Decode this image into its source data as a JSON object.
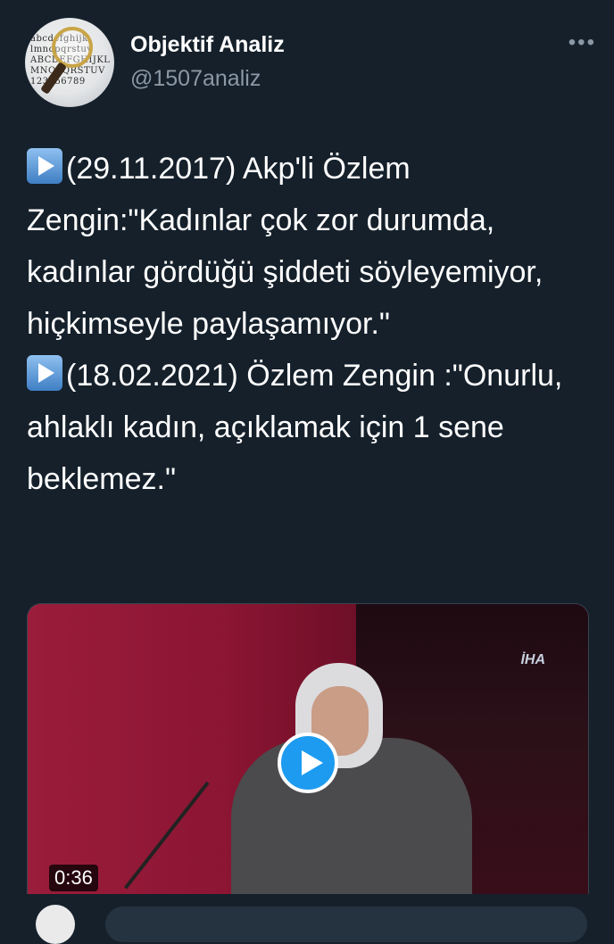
{
  "author": {
    "display_name": "Objektif Analiz",
    "handle": "@1507analiz",
    "avatar_text": "abcdefghijklmno pqrstuvwxyz ABCDEFGHIJKL MNOPQRSTUVW 123456789"
  },
  "more_label": "•••",
  "tweet": {
    "lines": [
      "(29.11.2017) Akp'li Özlem Zengin:\"Kadınlar çok zor durumda, kadınlar gördüğü şiddeti söyleyemiyor, hiçkimseyle paylaşamıyor.\"",
      "(18.02.2021) Özlem Zengin :\"Onurlu, ahlaklı kadın, açıklamak için 1 sene beklemez.\""
    ]
  },
  "media": {
    "logo": "İHA",
    "duration": "0:36"
  },
  "colors": {
    "background": "#15202b",
    "secondary_text": "#8b98a5",
    "accent": "#1d9bf0"
  }
}
